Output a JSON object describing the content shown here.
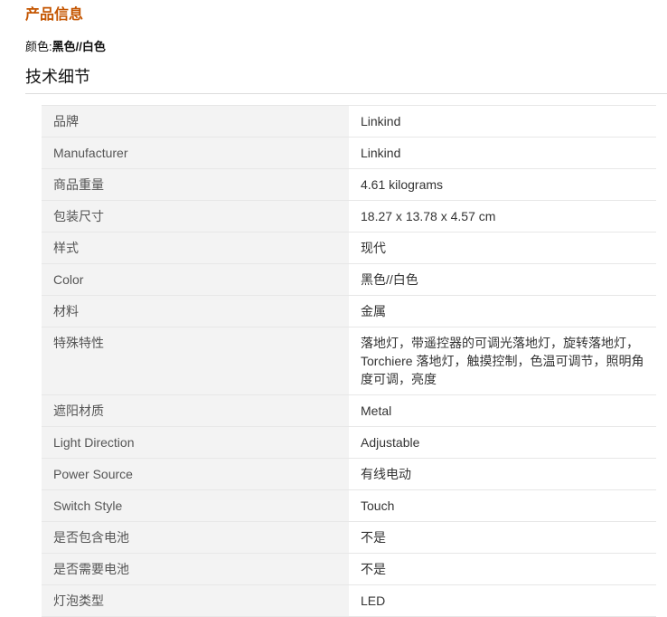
{
  "header": {
    "title": "产品信息",
    "color_label": "颜色:",
    "color_value": "黑色//白色",
    "section_title": "技术细节"
  },
  "specs": [
    {
      "key": "品牌",
      "value": "Linkind"
    },
    {
      "key": "Manufacturer",
      "value": "Linkind"
    },
    {
      "key": "商品重量",
      "value": "4.61 kilograms"
    },
    {
      "key": "包装尺寸",
      "value": "18.27 x 13.78 x 4.57 cm"
    },
    {
      "key": "样式",
      "value": "现代"
    },
    {
      "key": "Color",
      "value": "黑色//白色"
    },
    {
      "key": "材料",
      "value": "金属"
    },
    {
      "key": "特殊特性",
      "value": "落地灯，带遥控器的可调光落地灯，旋转落地灯，Torchiere 落地灯，触摸控制，色温可调节，照明角度可调，亮度"
    },
    {
      "key": "遮阳材质",
      "value": "Metal"
    },
    {
      "key": "Light Direction",
      "value": "Adjustable"
    },
    {
      "key": "Power Source",
      "value": "有线电动"
    },
    {
      "key": "Switch Style",
      "value": "Touch"
    },
    {
      "key": "是否包含电池",
      "value": "不是"
    },
    {
      "key": "是否需要电池",
      "value": "不是"
    },
    {
      "key": "灯泡类型",
      "value": "LED"
    }
  ]
}
